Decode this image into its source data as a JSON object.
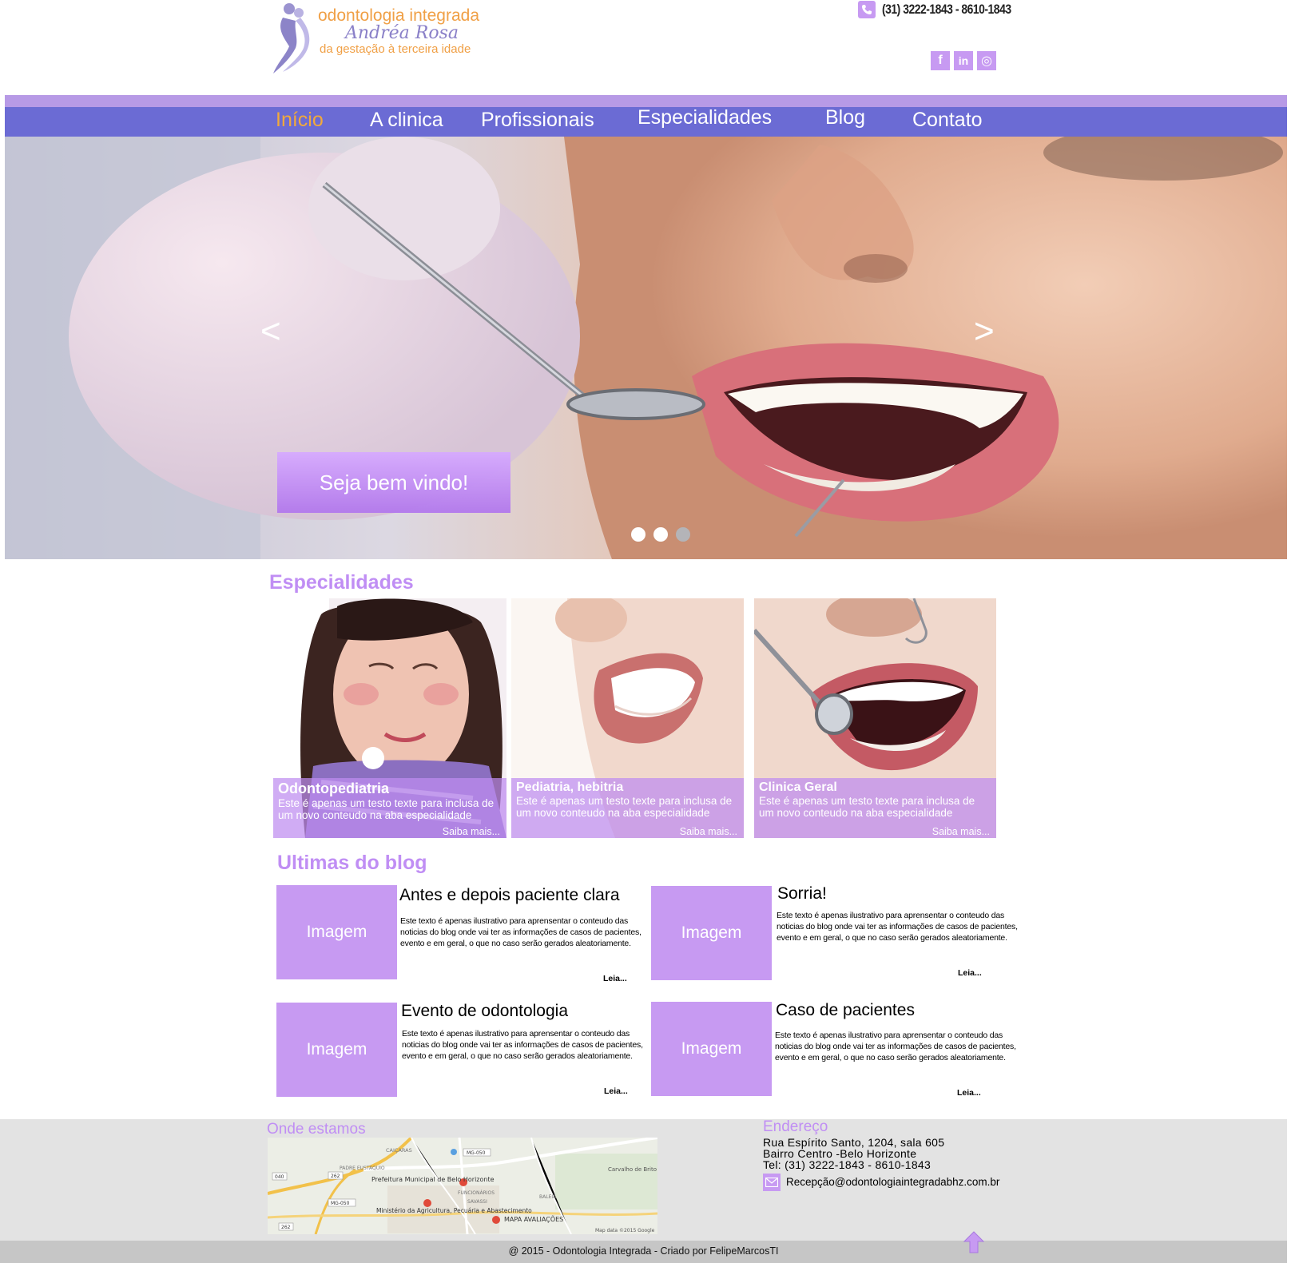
{
  "header": {
    "logo": {
      "line1": "odontologia integrada",
      "line2": "Andréa Rosa",
      "line3": "da gestação à terceira idade"
    },
    "phone": "(31) 3222-1843 - 8610-1843",
    "phone_icon": "phone-icon",
    "socials": [
      {
        "name": "facebook",
        "glyph": "f"
      },
      {
        "name": "linkedin",
        "glyph": "in"
      },
      {
        "name": "instagram",
        "glyph": "◎"
      }
    ]
  },
  "nav": {
    "items": [
      "Início",
      "A clinica",
      "Profissionais",
      "Especialidades",
      "Blog",
      "Contato"
    ],
    "active_index": 0,
    "active_color": "#f2a93b",
    "bar_color": "#6b6bd4"
  },
  "hero": {
    "prev": "<",
    "next": ">",
    "cta": "Seja bem vindo!",
    "slides_total": 3,
    "active_slide": 2
  },
  "specialties": {
    "title": "Especialidades",
    "cards": [
      {
        "title": "Odontopediatria",
        "desc": "Este é apenas um testo texte para inclusa de um novo conteudo na aba especialidade",
        "more": "Saiba mais..."
      },
      {
        "title": "Pediatria, hebitria",
        "desc": "Este é apenas um testo texte para inclusa de um novo conteudo na aba especialidade",
        "more": "Saiba mais..."
      },
      {
        "title": "Clinica Geral",
        "desc": "Este é apenas um testo texte para inclusa de um novo conteudo na aba especialidade",
        "more": "Saiba mais..."
      }
    ]
  },
  "blog": {
    "title": "Ultimas do blog",
    "posts": [
      {
        "image_label": "Imagem",
        "title": "Antes e depois paciente clara",
        "text": "Este texto é apenas ilustrativo para aprensentar o  conteudo das noticias do blog onde vai ter as informações de casos de pacientes, evento e em geral, o que no caso serão gerados aleatoriamente.",
        "more": "Leia..."
      },
      {
        "image_label": "Imagem",
        "title": "Sorria!",
        "text": "Este texto é apenas ilustrativo para aprensentar o  conteudo das noticias do blog onde vai ter as informações de casos de pacientes, evento e em geral, o que no caso serão gerados aleatoriamente.",
        "more": "Leia..."
      },
      {
        "image_label": "Imagem",
        "title": "Evento de odontologia",
        "text": "Este texto é apenas ilustrativo para aprensentar o  conteudo das noticias do blog onde vai ter as informações de casos de pacientes, evento e em geral, o que no caso serão gerados aleatoriamente.",
        "more": "Leia..."
      },
      {
        "image_label": "Imagem",
        "title": "Caso de pacientes",
        "text": "Este texto é apenas ilustrativo para aprensentar o  conteudo das noticias do blog onde vai ter as informações de casos de pacientes, evento e em geral, o que no caso serão gerados aleatoriamente.",
        "more": "Leia..."
      }
    ]
  },
  "footer": {
    "map_title": "Onde estamos",
    "map_labels": {
      "caicaras": "CAIÇARAS",
      "padre": "PADRE EUSTÁQUIO",
      "prefeitura": "Prefeitura Municipal de Belo Horizonte",
      "funcionarios": "FUNCIONÁRIOS",
      "savassi": "SAVASSI",
      "ministerio": "Ministério da Agricultura, Pecuária e Abastecimento",
      "avaliacoes": "MAPA AVALIAÇÕES",
      "carvalho": "Carvalho de Brito",
      "baleia": "BALEIA",
      "attribution": "Map data ©2015 Google",
      "road1": "MG-050",
      "road2": "040",
      "road3": "262",
      "road4": "MG-050",
      "road5": "262"
    },
    "address_title": "Endereço",
    "address_line1": "Rua Espírito Santo, 1204, sala 605",
    "address_line2": "Bairro Centro -Belo Horizonte",
    "address_line3": "Tel: (31) 3222-1843 - 8610-1843",
    "email": "Recepção@odontologiaintegradabhz.com.br",
    "copyright": "@ 2015 - Odontologia Integrada - Criado por FelipeMarcosTI"
  },
  "colors": {
    "accent_purple": "#c79af2",
    "title_purple": "#c08ef4",
    "nav_blue": "#6b6bd4",
    "orange": "#f2a93b"
  }
}
